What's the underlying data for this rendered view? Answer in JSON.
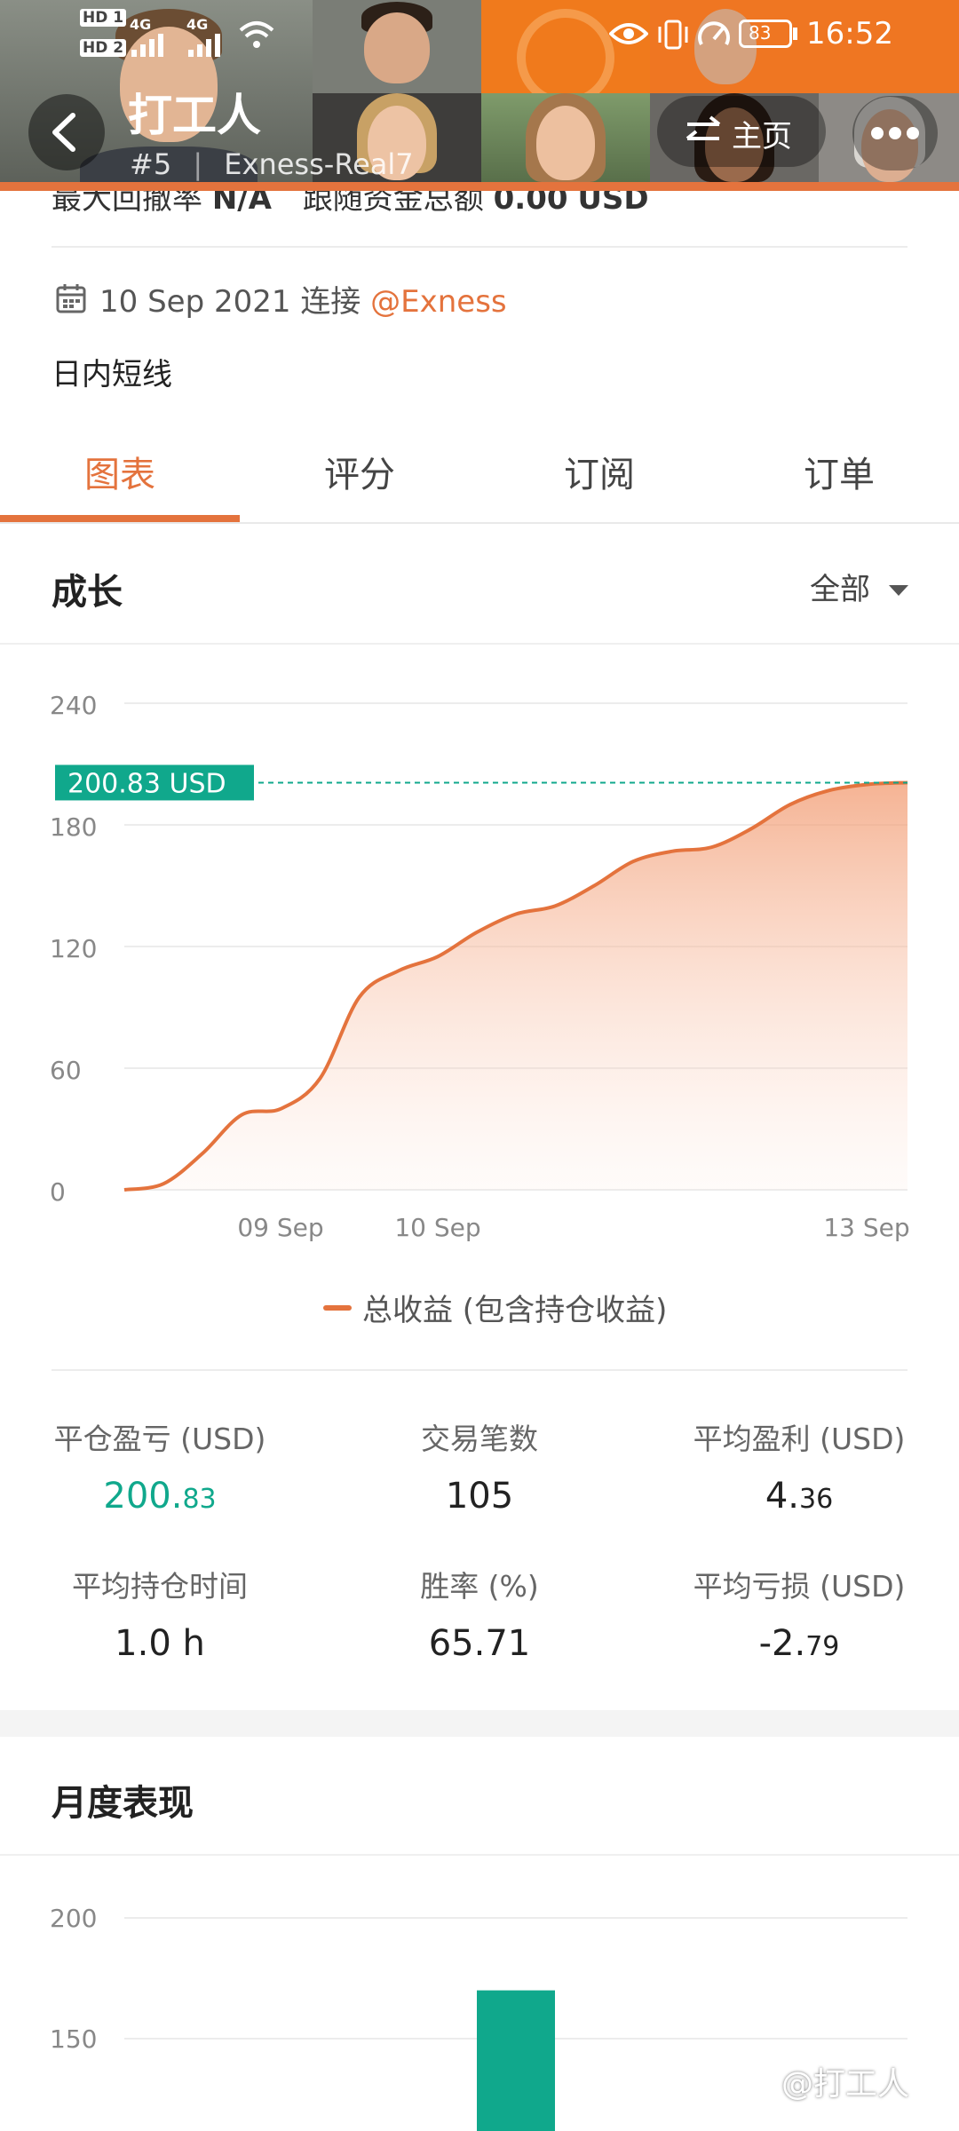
{
  "status_bar": {
    "network": "4G",
    "network2": "4G",
    "hd1": "HD 1",
    "hd2": "HD 2",
    "battery": "83",
    "time": "16:52"
  },
  "header": {
    "title": "打工人",
    "rank": "#5",
    "account": "Exness-Real7",
    "home_label": "主页",
    "icons": {
      "back": "back-arrow-icon",
      "swap": "swap-icon",
      "more": "more-icon"
    }
  },
  "summary_partial": {
    "text1": "最大回撤率",
    "text2": "N/A",
    "text3": "跟随资金总额",
    "text4": "0.00",
    "text5": "USD"
  },
  "connection": {
    "date": "10 Sep 2021",
    "verb": "连接",
    "broker": "@Exness"
  },
  "description": "日内短线",
  "tabs": [
    {
      "label": "图表"
    },
    {
      "label": "评分"
    },
    {
      "label": "订阅"
    },
    {
      "label": "订单"
    }
  ],
  "growth": {
    "title": "成长",
    "filter": "全部",
    "current_tag": "200.83 USD",
    "legend": "总收益 (包含持仓收益)"
  },
  "chart_data": [
    {
      "type": "area",
      "title": "成长",
      "ylim": [
        0,
        240
      ],
      "y_ticks": [
        "0",
        "60",
        "120",
        "180",
        "240"
      ],
      "x_tick_labels": [
        "09 Sep",
        "10 Sep",
        "13 Sep"
      ],
      "grid": true,
      "series": [
        {
          "name": "总收益 (包含持仓收益)",
          "x": [
            0,
            0.05,
            0.1,
            0.15,
            0.2,
            0.25,
            0.3,
            0.35,
            0.4,
            0.45,
            0.5,
            0.55,
            0.6,
            0.65,
            0.7,
            0.75,
            0.8,
            0.85,
            0.9,
            0.95,
            1.0
          ],
          "y": [
            0,
            3,
            18,
            37,
            40,
            55,
            95,
            108,
            115,
            127,
            136,
            140,
            150,
            162,
            167,
            169,
            178,
            190,
            197,
            200,
            200.83
          ]
        }
      ],
      "reference_value": 200.83,
      "colors": {
        "line": "#e4733d",
        "reference": "#10a88c"
      }
    },
    {
      "type": "bar",
      "title": "月度表现",
      "y_ticks": [
        "150",
        "200"
      ],
      "categories": [
        ""
      ],
      "values": [
        170
      ],
      "colors": {
        "bar": "#10a88c"
      }
    }
  ],
  "stats": {
    "row1": [
      {
        "label": "平仓盈亏 (USD)",
        "value_main": "200.",
        "value_small": "83",
        "color": "#10a88c"
      },
      {
        "label": "交易笔数",
        "value_main": "105",
        "value_small": ""
      },
      {
        "label": "平均盈利 (USD)",
        "value_main": "4.",
        "value_small": "36"
      }
    ],
    "row2": [
      {
        "label": "平均持仓时间",
        "value_main": "1.0 h",
        "value_small": ""
      },
      {
        "label": "胜率 (%)",
        "value_main": "65.71",
        "value_small": ""
      },
      {
        "label": "平均亏损 (USD)",
        "value_main": "-2.",
        "value_small": "79"
      }
    ]
  },
  "monthly": {
    "title": "月度表现"
  },
  "watermark": "@打工人"
}
